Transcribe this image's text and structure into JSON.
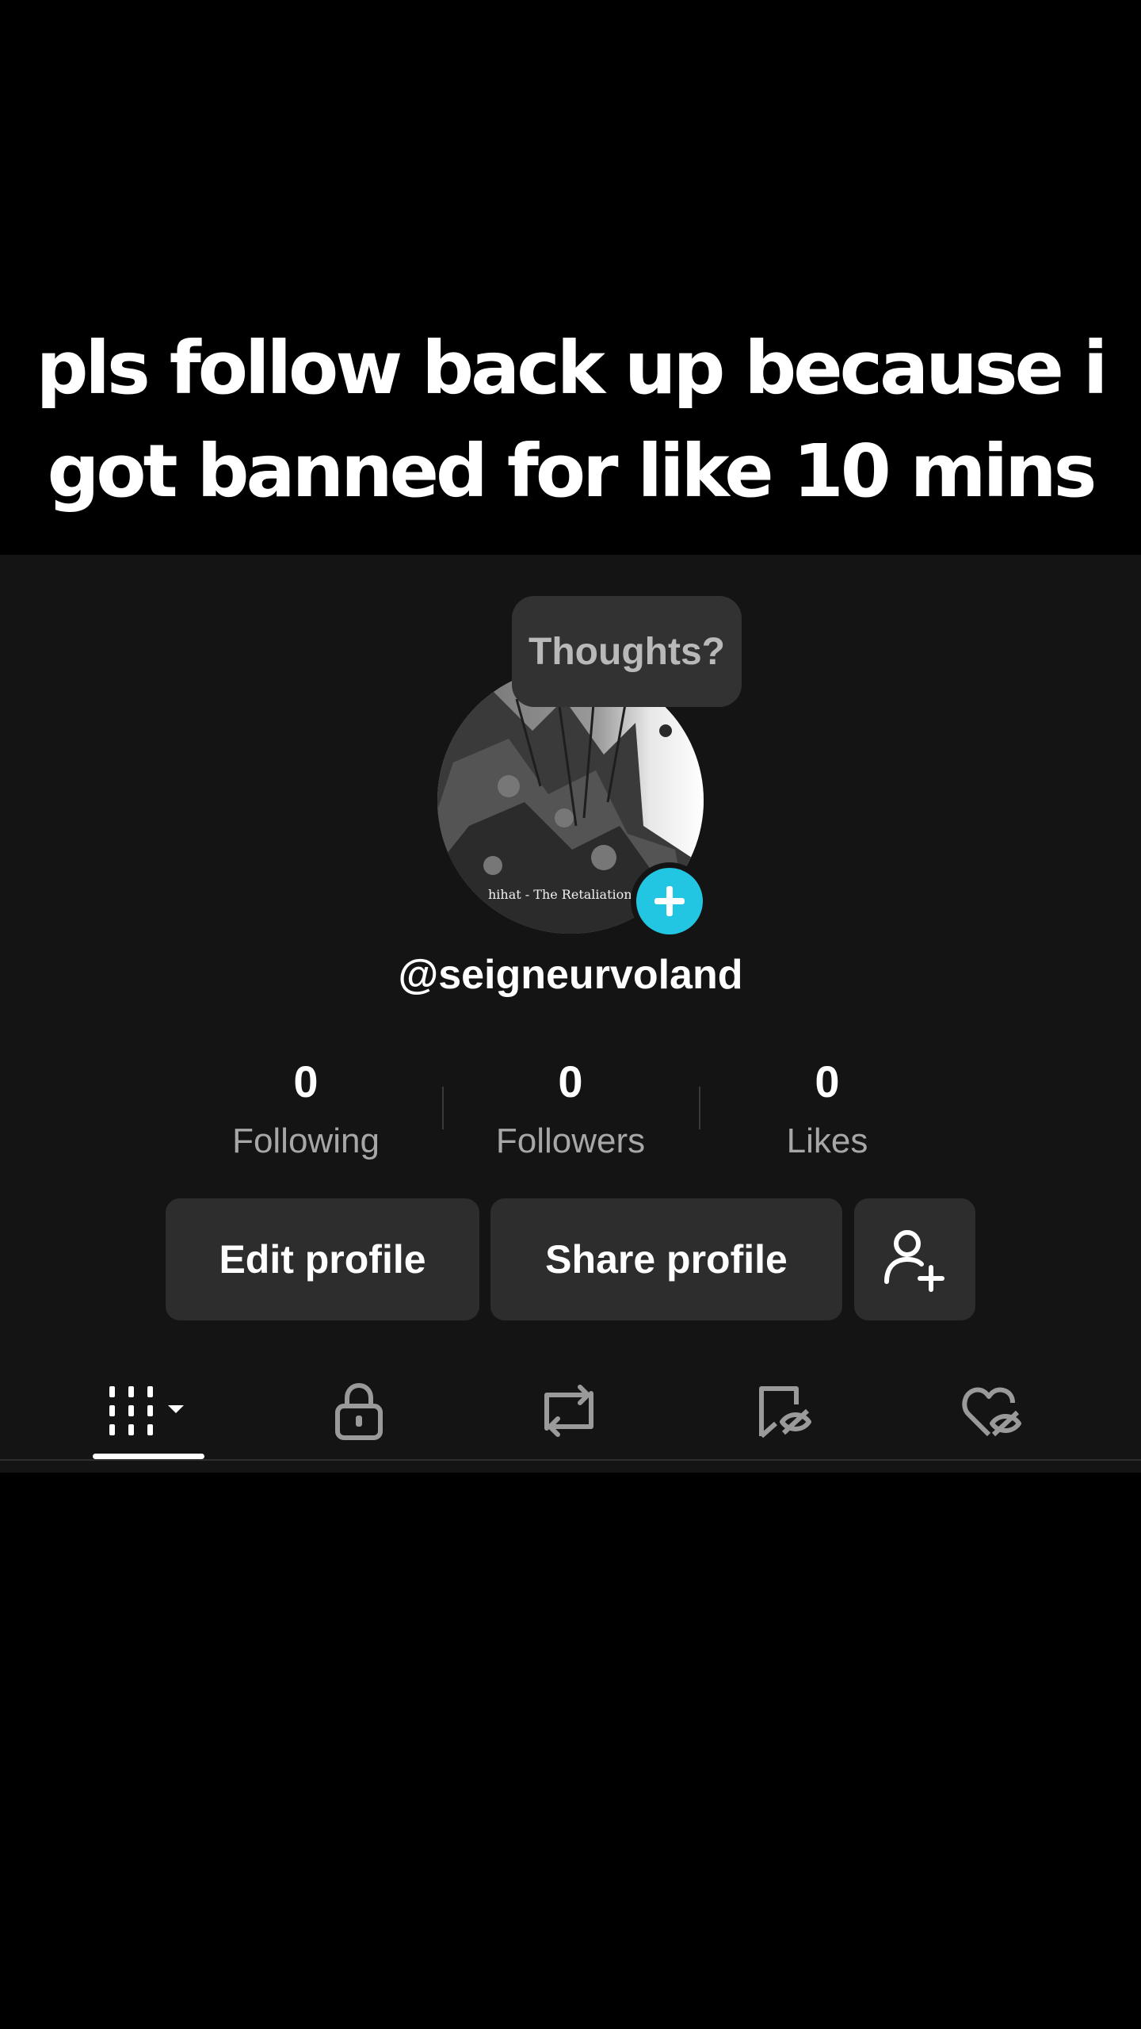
{
  "caption": {
    "line1": "pls follow back up because i",
    "line2": "got banned for like 10 mins"
  },
  "profile": {
    "thought_bubble": "Thoughts?",
    "avatar_caption": "hihat - The Retaliation",
    "username": "@seigneurvoland",
    "stats": {
      "following": {
        "value": "0",
        "label": "Following"
      },
      "followers": {
        "value": "0",
        "label": "Followers"
      },
      "likes": {
        "value": "0",
        "label": "Likes"
      }
    },
    "buttons": {
      "edit": "Edit profile",
      "share": "Share profile"
    }
  },
  "tabs": [
    {
      "icon": "grid-icon",
      "active": true
    },
    {
      "icon": "lock-icon"
    },
    {
      "icon": "repost-icon"
    },
    {
      "icon": "bookmark-hidden-icon"
    },
    {
      "icon": "heart-hidden-icon"
    }
  ],
  "colors": {
    "accent": "#23c6e2",
    "panel": "#141414",
    "button": "#2d2d2d"
  }
}
